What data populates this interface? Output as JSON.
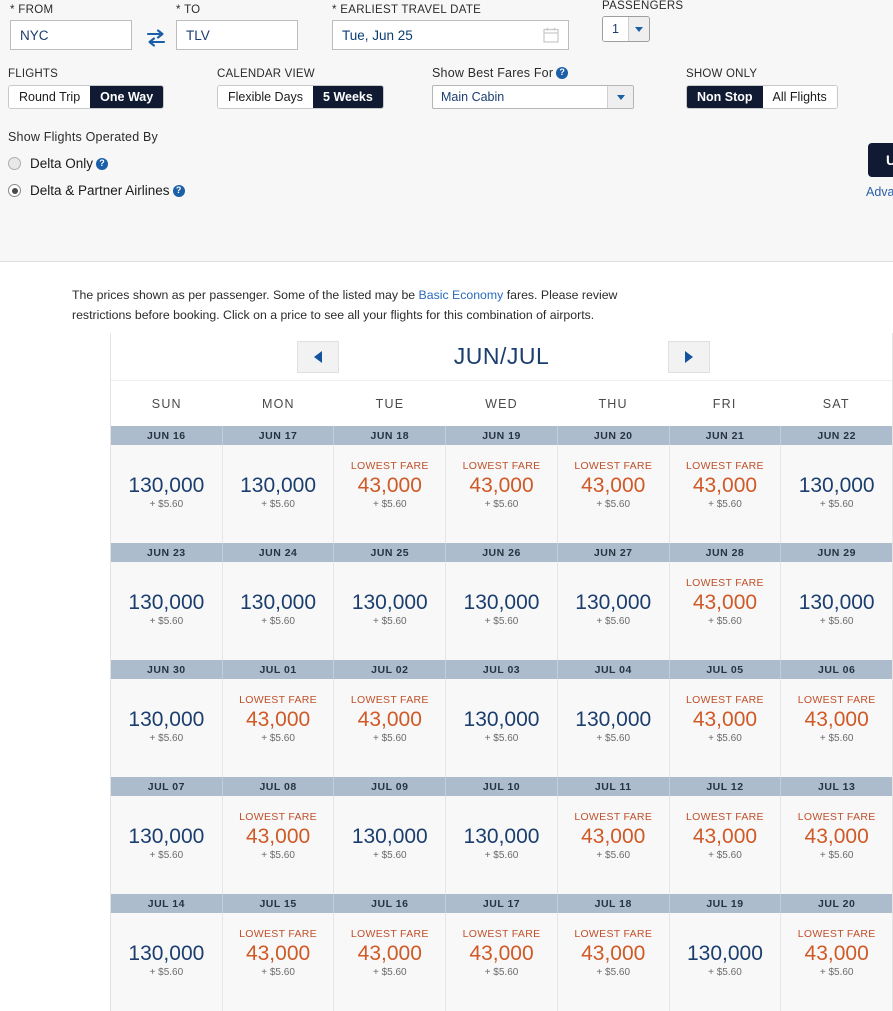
{
  "search": {
    "from": {
      "label": "* FROM",
      "value": "NYC"
    },
    "to": {
      "label": "* TO",
      "value": "TLV"
    },
    "swap_icon": "swap-horizontal-icon",
    "date": {
      "label": "* EARLIEST TRAVEL DATE",
      "value": "Tue, Jun 25",
      "icon": "calendar-icon"
    },
    "passengers": {
      "label": "PASSENGERS",
      "value": "1"
    },
    "flights": {
      "label": "FLIGHTS",
      "options": [
        "Round Trip",
        "One Way"
      ],
      "selected": "One Way"
    },
    "calendar_view": {
      "label": "CALENDAR VIEW",
      "options": [
        "Flexible Days",
        "5 Weeks"
      ],
      "selected": "5 Weeks"
    },
    "best_fares": {
      "label": "Show Best Fares For",
      "value": "Main Cabin",
      "help_icon": "help-icon"
    },
    "show_only": {
      "label": "SHOW ONLY",
      "options": [
        "Non Stop",
        "All Flights"
      ],
      "selected": "Non Stop"
    },
    "operated_by": {
      "label": "Show Flights Operated By",
      "options": [
        {
          "label": "Delta Only",
          "checked": false,
          "help_icon": "help-icon"
        },
        {
          "label": "Delta & Partner Airlines",
          "checked": true,
          "help_icon": "help-icon"
        }
      ]
    },
    "update_button": "U",
    "advanced_search": "Adva"
  },
  "notice": {
    "part1": "The prices shown as per passenger. Some of the listed may be ",
    "link": "Basic Economy",
    "part2": " fares. Please review restrictions before booking. Click on a price to see all your flights for this combination of airports."
  },
  "calendar": {
    "title": "JUN/JUL",
    "prev_icon": "arrow-left-icon",
    "next_icon": "arrow-right-icon",
    "day_headers": [
      "SUN",
      "MON",
      "TUE",
      "WED",
      "THU",
      "FRI",
      "SAT"
    ],
    "lowest_fare_tag": "LOWEST FARE",
    "colors": {
      "lowest": "#cf5a27",
      "regular": "#1b3e6f",
      "date_header": "#adbccd",
      "accent_dark": "#101b33"
    },
    "weeks": [
      {
        "dates": [
          "JUN 16",
          "JUN 17",
          "JUN 18",
          "JUN 19",
          "JUN 20",
          "JUN 21",
          "JUN 22"
        ],
        "fares": [
          {
            "miles": "130,000",
            "tax": "+ $5.60",
            "lowest": false
          },
          {
            "miles": "130,000",
            "tax": "+ $5.60",
            "lowest": false
          },
          {
            "miles": "43,000",
            "tax": "+ $5.60",
            "lowest": true
          },
          {
            "miles": "43,000",
            "tax": "+ $5.60",
            "lowest": true
          },
          {
            "miles": "43,000",
            "tax": "+ $5.60",
            "lowest": true
          },
          {
            "miles": "43,000",
            "tax": "+ $5.60",
            "lowest": true
          },
          {
            "miles": "130,000",
            "tax": "+ $5.60",
            "lowest": false
          }
        ]
      },
      {
        "dates": [
          "JUN 23",
          "JUN 24",
          "JUN 25",
          "JUN 26",
          "JUN 27",
          "JUN 28",
          "JUN 29"
        ],
        "fares": [
          {
            "miles": "130,000",
            "tax": "+ $5.60",
            "lowest": false
          },
          {
            "miles": "130,000",
            "tax": "+ $5.60",
            "lowest": false
          },
          {
            "miles": "130,000",
            "tax": "+ $5.60",
            "lowest": false
          },
          {
            "miles": "130,000",
            "tax": "+ $5.60",
            "lowest": false
          },
          {
            "miles": "130,000",
            "tax": "+ $5.60",
            "lowest": false
          },
          {
            "miles": "43,000",
            "tax": "+ $5.60",
            "lowest": true
          },
          {
            "miles": "130,000",
            "tax": "+ $5.60",
            "lowest": false
          }
        ]
      },
      {
        "dates": [
          "JUN 30",
          "JUL 01",
          "JUL 02",
          "JUL 03",
          "JUL 04",
          "JUL 05",
          "JUL 06"
        ],
        "fares": [
          {
            "miles": "130,000",
            "tax": "+ $5.60",
            "lowest": false
          },
          {
            "miles": "43,000",
            "tax": "+ $5.60",
            "lowest": true
          },
          {
            "miles": "43,000",
            "tax": "+ $5.60",
            "lowest": true
          },
          {
            "miles": "130,000",
            "tax": "+ $5.60",
            "lowest": false
          },
          {
            "miles": "130,000",
            "tax": "+ $5.60",
            "lowest": false
          },
          {
            "miles": "43,000",
            "tax": "+ $5.60",
            "lowest": true
          },
          {
            "miles": "43,000",
            "tax": "+ $5.60",
            "lowest": true
          }
        ]
      },
      {
        "dates": [
          "JUL 07",
          "JUL 08",
          "JUL 09",
          "JUL 10",
          "JUL 11",
          "JUL 12",
          "JUL 13"
        ],
        "fares": [
          {
            "miles": "130,000",
            "tax": "+ $5.60",
            "lowest": false
          },
          {
            "miles": "43,000",
            "tax": "+ $5.60",
            "lowest": true
          },
          {
            "miles": "130,000",
            "tax": "+ $5.60",
            "lowest": false
          },
          {
            "miles": "130,000",
            "tax": "+ $5.60",
            "lowest": false
          },
          {
            "miles": "43,000",
            "tax": "+ $5.60",
            "lowest": true
          },
          {
            "miles": "43,000",
            "tax": "+ $5.60",
            "lowest": true
          },
          {
            "miles": "43,000",
            "tax": "+ $5.60",
            "lowest": true
          }
        ]
      },
      {
        "dates": [
          "JUL 14",
          "JUL 15",
          "JUL 16",
          "JUL 17",
          "JUL 18",
          "JUL 19",
          "JUL 20"
        ],
        "fares": [
          {
            "miles": "130,000",
            "tax": "+ $5.60",
            "lowest": false
          },
          {
            "miles": "43,000",
            "tax": "+ $5.60",
            "lowest": true
          },
          {
            "miles": "43,000",
            "tax": "+ $5.60",
            "lowest": true
          },
          {
            "miles": "43,000",
            "tax": "+ $5.60",
            "lowest": true
          },
          {
            "miles": "43,000",
            "tax": "+ $5.60",
            "lowest": true
          },
          {
            "miles": "130,000",
            "tax": "+ $5.60",
            "lowest": false
          },
          {
            "miles": "43,000",
            "tax": "+ $5.60",
            "lowest": true
          }
        ]
      }
    ]
  }
}
